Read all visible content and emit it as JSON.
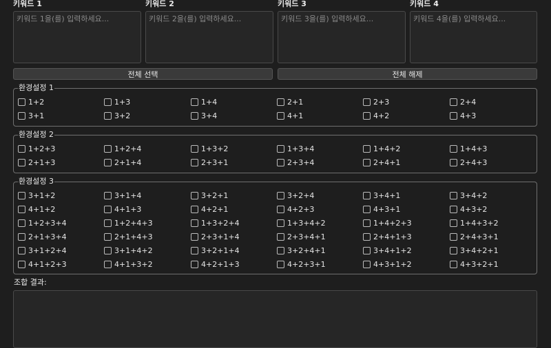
{
  "keywords": [
    {
      "label": "키워드 1",
      "placeholder": "키워드 1을(를) 입력하세요..."
    },
    {
      "label": "키워드 2",
      "placeholder": "키워드 2을(를) 입력하세요..."
    },
    {
      "label": "키워드 3",
      "placeholder": "키워드 3을(를) 입력하세요..."
    },
    {
      "label": "키워드 4",
      "placeholder": "키워드 4을(를) 입력하세요..."
    }
  ],
  "buttons": {
    "select_all": "전체 선택",
    "deselect_all": "전체 해제"
  },
  "groups": [
    {
      "title": "환경설정 1",
      "options": [
        "1+2",
        "1+3",
        "1+4",
        "2+1",
        "2+3",
        "2+4",
        "3+1",
        "3+2",
        "3+4",
        "4+1",
        "4+2",
        "4+3"
      ]
    },
    {
      "title": "환경설정 2",
      "options": [
        "1+2+3",
        "1+2+4",
        "1+3+2",
        "1+3+4",
        "1+4+2",
        "1+4+3",
        "2+1+3",
        "2+1+4",
        "2+3+1",
        "2+3+4",
        "2+4+1",
        "2+4+3"
      ]
    },
    {
      "title": "환경설정 3",
      "options": [
        "3+1+2",
        "3+1+4",
        "3+2+1",
        "3+2+4",
        "3+4+1",
        "3+4+2",
        "4+1+2",
        "4+1+3",
        "4+2+1",
        "4+2+3",
        "4+3+1",
        "4+3+2",
        "1+2+3+4",
        "1+2+4+3",
        "1+3+2+4",
        "1+3+4+2",
        "1+4+2+3",
        "1+4+3+2",
        "2+1+3+4",
        "2+1+4+3",
        "2+3+1+4",
        "2+3+4+1",
        "2+4+1+3",
        "2+4+3+1",
        "3+1+2+4",
        "3+1+4+2",
        "3+2+1+4",
        "3+2+4+1",
        "3+4+1+2",
        "3+4+2+1",
        "4+1+2+3",
        "4+1+3+2",
        "4+2+1+3",
        "4+2+3+1",
        "4+3+1+2",
        "4+3+2+1"
      ]
    }
  ],
  "result": {
    "label": "조합 결과:",
    "value": ""
  }
}
